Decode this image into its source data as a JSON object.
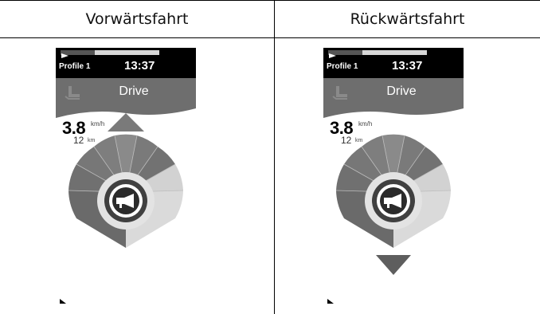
{
  "table": {
    "columns": [
      {
        "header": "Vorwärtsfahrt"
      },
      {
        "header": "Rückwärtsfahrt"
      }
    ]
  },
  "screens": [
    {
      "profile": "Profile 1",
      "time": "13:37",
      "mode": "Drive",
      "speed_value": "3.8",
      "speed_unit": "km/h",
      "distance_value": "12",
      "distance_unit": "km",
      "direction_arrow": "up",
      "battery_level": 0.35
    },
    {
      "profile": "Profile 1",
      "time": "13:37",
      "mode": "Drive",
      "speed_value": "3.8",
      "speed_unit": "km/h",
      "distance_value": "12",
      "distance_unit": "km",
      "direction_arrow": "down",
      "battery_level": 0.35
    }
  ],
  "icons": {
    "center": "horn-icon",
    "header": "seat-icon",
    "forward": "arrow-up-icon",
    "reverse": "arrow-down-icon"
  },
  "colors": {
    "status_bar": "#000000",
    "drive_bar": "#6e6e6e",
    "gauge_dark": "#6a6a6a",
    "gauge_light": "#cfcfcf",
    "horn_bg": "#3f3f3f"
  }
}
